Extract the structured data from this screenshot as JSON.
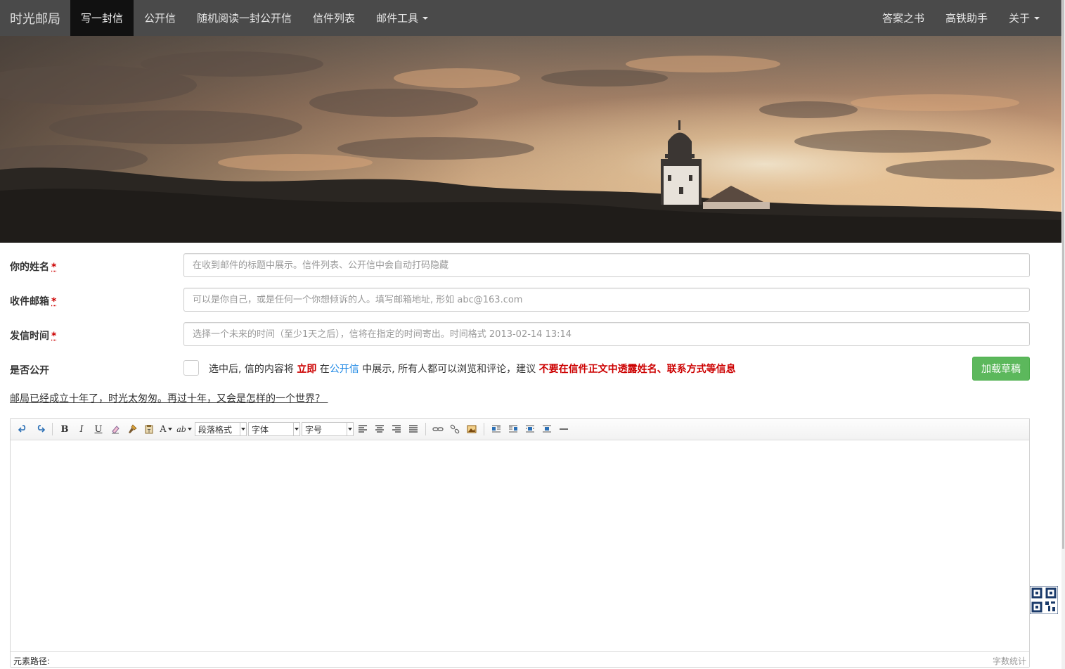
{
  "nav": {
    "brand": "时光邮局",
    "items": [
      {
        "label": "写一封信",
        "active": true
      },
      {
        "label": "公开信",
        "active": false
      },
      {
        "label": "随机阅读一封公开信",
        "active": false
      },
      {
        "label": "信件列表",
        "active": false
      },
      {
        "label": "邮件工具",
        "active": false,
        "dropdown": true
      }
    ],
    "right_items": [
      {
        "label": "答案之书"
      },
      {
        "label": "高铁助手"
      },
      {
        "label": "关于",
        "dropdown": true
      }
    ]
  },
  "form": {
    "name": {
      "label": "你的姓名",
      "required_mark": "*",
      "placeholder": "在收到邮件的标题中展示。信件列表、公开信中会自动打码隐藏",
      "value": ""
    },
    "email": {
      "label": "收件邮箱",
      "required_mark": "*",
      "placeholder": "可以是你自己，或是任何一个你想倾诉的人。填写邮箱地址, 形如 abc@163.com",
      "value": ""
    },
    "send_time": {
      "label": "发信时间",
      "required_mark": "*",
      "placeholder": "选择一个未来的时间（至少1天之后），信将在指定的时间寄出。时间格式 2013-02-14 13:14",
      "value": ""
    },
    "public": {
      "label": "是否公开",
      "checked": false,
      "text_1": "选中后, 信的内容将 ",
      "text_immediate": "立即",
      "text_2": " 在",
      "text_link": "公开信",
      "text_3": " 中展示, 所有人都可以浏览和评论，建议 ",
      "text_warning": "不要在信件正文中透露姓名、联系方式等信息"
    },
    "load_draft_button": "加载草稿"
  },
  "slogan": "邮局已经成立十年了，时光太匆匆。再过十年，又会是怎样的一个世界？ ",
  "editor": {
    "selects": {
      "paragraph": "段落格式",
      "font": "字体",
      "size": "字号"
    },
    "status_path": "元素路径:",
    "word_count": "字数统计"
  },
  "colors": {
    "navbar_bg": "#4a4a4a",
    "navbar_active_bg": "#111111",
    "required": "#cc0000",
    "link": "#1e88e5",
    "button_green": "#5cb85c"
  }
}
